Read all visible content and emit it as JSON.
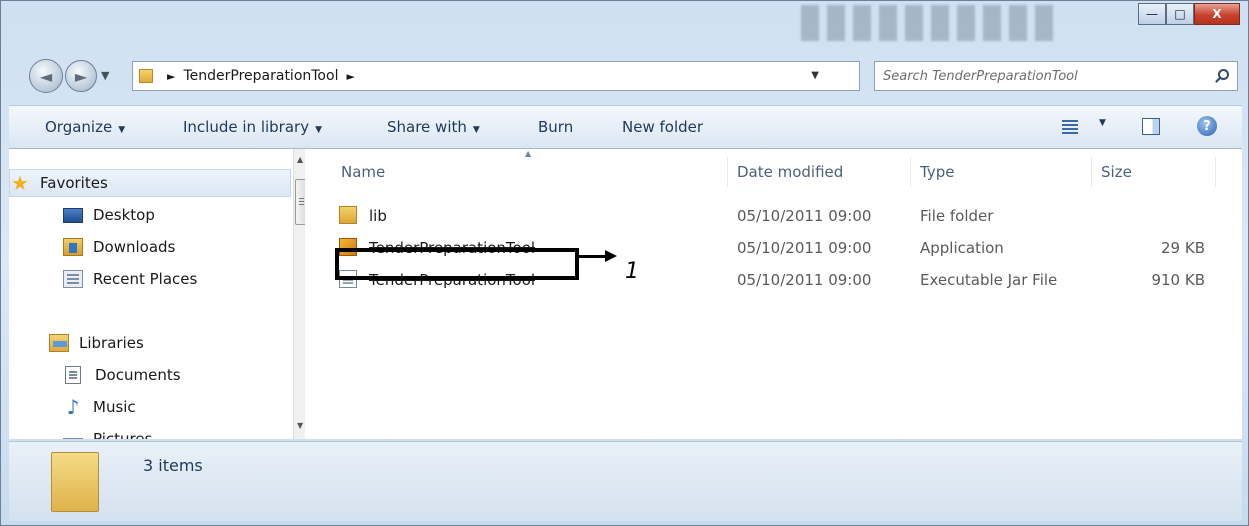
{
  "window": {
    "minimize_label": "—",
    "maximize_label": "□",
    "close_label": "X"
  },
  "address": {
    "back_glyph": "◄",
    "forward_glyph": "►",
    "recent_glyph": "▼",
    "path_segment": "TenderPreparationTool",
    "separator": "►",
    "dropdown_glyph": "▼",
    "refresh_glyph": "↻"
  },
  "search": {
    "placeholder": "Search TenderPreparationTool"
  },
  "toolbar": {
    "organize": "Organize",
    "include_in_library": "Include in library",
    "share_with": "Share with",
    "burn": "Burn",
    "new_folder": "New folder",
    "caret": "▼",
    "help": "?"
  },
  "navigation": {
    "favorites": "Favorites",
    "desktop": "Desktop",
    "downloads": "Downloads",
    "recent_places": "Recent Places",
    "libraries": "Libraries",
    "documents": "Documents",
    "music": "Music",
    "pictures": "Pictures",
    "icons": {
      "favorites": "star-icon",
      "desktop": "desktop-icon",
      "downloads": "downloads-icon",
      "recent_places": "recent-places-icon",
      "libraries": "libraries-icon",
      "documents": "documents-icon",
      "music": "music-icon",
      "pictures": "pictures-icon"
    },
    "scroll_up": "▲",
    "scroll_down": "▼"
  },
  "columns": {
    "name": "Name",
    "date_modified": "Date modified",
    "type": "Type",
    "size": "Size",
    "sort_glyph": "▲"
  },
  "files": [
    {
      "name": "lib",
      "date": "05/10/2011 09:00",
      "type": "File folder",
      "size": "",
      "icon": "folder-icon"
    },
    {
      "name": "TenderPreparationTool",
      "date": "05/10/2011 09:00",
      "type": "Application",
      "size": "29 KB",
      "icon": "application-icon"
    },
    {
      "name": "TenderPreparationTool",
      "date": "05/10/2011 09:00",
      "type": "Executable Jar File",
      "size": "910 KB",
      "icon": "jar-file-icon"
    }
  ],
  "status": {
    "item_count": "3 items"
  },
  "annotation": {
    "number": "1"
  },
  "colors": {
    "frame": "#cfe0f2",
    "toolbar_text": "#1e395b",
    "close_button": "#c9422d",
    "favorites_star": "#f2b01e"
  }
}
